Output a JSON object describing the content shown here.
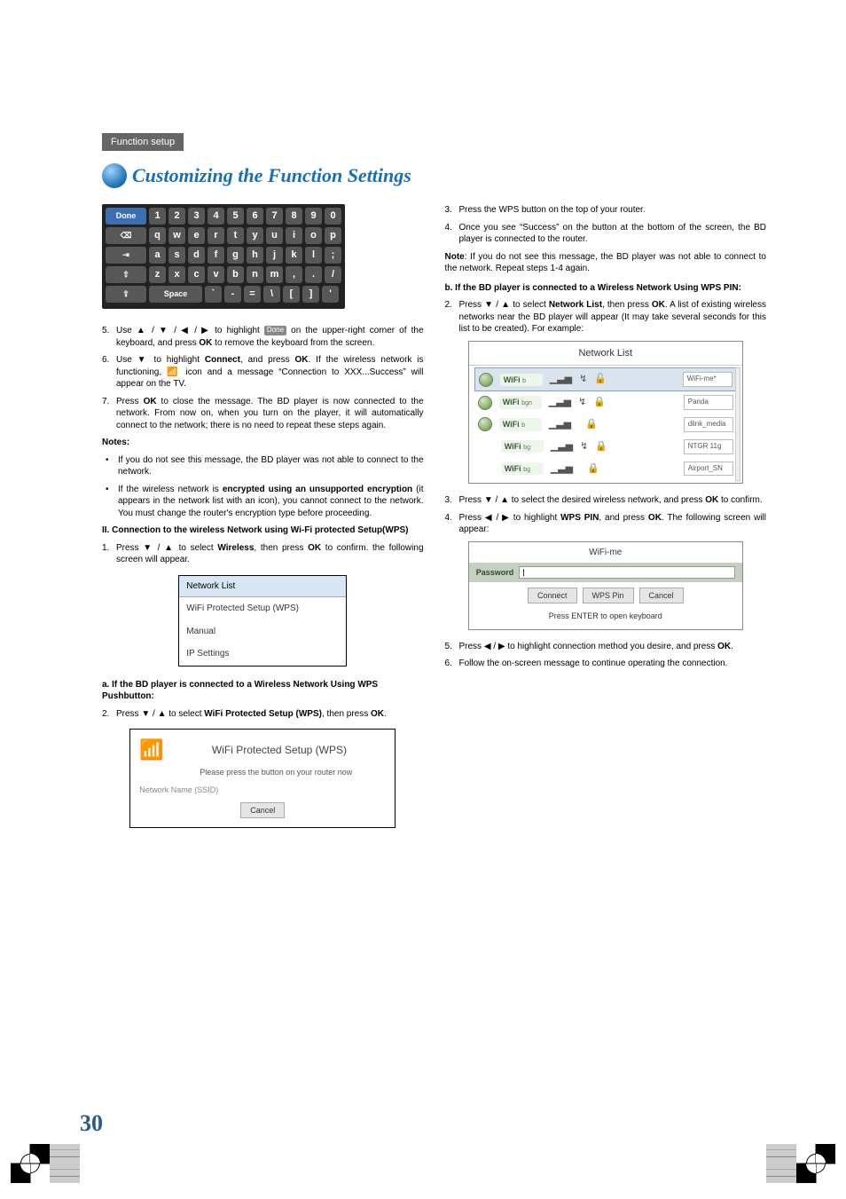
{
  "header": {
    "section": "Function setup"
  },
  "title": "Customizing the Function Settings",
  "keyboard": {
    "row1_first": "Done",
    "row1": [
      "1",
      "2",
      "3",
      "4",
      "5",
      "6",
      "7",
      "8",
      "9",
      "0"
    ],
    "row2_first": "⌫",
    "row2": [
      "q",
      "w",
      "e",
      "r",
      "t",
      "y",
      "u",
      "i",
      "o",
      "p"
    ],
    "row3_first": "⇥",
    "row3": [
      "a",
      "s",
      "d",
      "f",
      "g",
      "h",
      "j",
      "k",
      "l",
      ";"
    ],
    "row4_first": "⇧",
    "row4": [
      "z",
      "x",
      "c",
      "v",
      "b",
      "n",
      "m",
      ",",
      ".",
      "/"
    ],
    "row5_first": "⇪",
    "row5_space": "Space",
    "row5": [
      "`",
      "-",
      "=",
      "\\",
      "[",
      "]",
      "'"
    ]
  },
  "left": {
    "s5_pre": "Use ▲ / ▼ / ◀ / ▶ to highlight ",
    "s5_chip": "Done",
    "s5_post": " on the upper-right corner of the keyboard, and press ",
    "s5_ok": "OK",
    "s5_end": " to remove the keyboard from the screen.",
    "s6_a": "Use ▼ to highlight ",
    "s6_b": "Connect",
    "s6_c": ", and press ",
    "s6_d": "OK",
    "s6_e": ". If the wireless network is functioning, ",
    "s6_icon": "📶",
    "s6_f": " icon and a message “Connection to XXX...Success” will appear on the TV.",
    "s7_a": "Press ",
    "s7_b": "OK",
    "s7_c": " to close the message. The BD player is now connected to the network. From now on, when you turn on the player, it will automatically connect to the network; there is no need to repeat these steps again.",
    "notes_label": "Notes:",
    "note1": "If you do not see this message, the BD player was not able to connect to the network.",
    "note2_a": "If the wireless network is ",
    "note2_b": "encrypted using an unsupported encryption",
    "note2_c": " (it appears in the network list with an icon), you cannot connect to the network. You must change the router's encryption type before proceeding.",
    "ii_head": "II. Connection to the wireless Network using Wi-Fi protected Setup(WPS)",
    "ii_1_a": "Press ▼ / ▲ to select ",
    "ii_1_b": "Wireless",
    "ii_1_c": ", then press ",
    "ii_1_d": "OK",
    "ii_1_e": " to confirm. the following screen will appear.",
    "menu": {
      "head": "Network List",
      "i1": "WiFi Protected Setup (WPS)",
      "i2": "Manual",
      "i3": "IP Settings"
    },
    "a_head": "a. If the BD player is connected to a Wireless Network Using WPS Pushbutton:",
    "a2_a": "Press ▼ / ▲ to select ",
    "a2_b": "WiFi Protected Setup (WPS)",
    "a2_c": ", then press ",
    "a2_d": "OK",
    "a2_e": ".",
    "wps": {
      "title": "WiFi Protected Setup (WPS)",
      "sub": "Please press the button on your router now",
      "ssid": "Network Name (SSID)",
      "cancel": "Cancel"
    }
  },
  "right": {
    "s3": "Press the WPS button on the top of your router.",
    "s4": "Once you see “Success” on the button at the bottom of the screen, the BD player is connected to the router.",
    "note_a": "Note",
    "note_b": ": If you do not see this message, the BD player was not able to connect to the network. Repeat steps 1-4 again.",
    "b_head": "b. If the BD player is connected to a Wireless Network Using WPS PIN:",
    "b2_a": "Press ▼ / ▲ to select ",
    "b2_b": "Network List",
    "b2_c": ", then press ",
    "b2_d": "OK",
    "b2_e": ". A list of existing wireless networks near the BD player will appear (It may take several seconds for this list to be created). For example:",
    "netlist": {
      "title": "Network List",
      "rows": [
        {
          "ssid": "WiFi",
          "badge": "b",
          "name": "WiFi-me*",
          "wps": "↯",
          "lock": "🔓",
          "globe": true
        },
        {
          "ssid": "WiFi",
          "badge": "bgn",
          "name": "Panda",
          "wps": "↯",
          "lock": "🔒",
          "globe": true
        },
        {
          "ssid": "WiFi",
          "badge": "b",
          "name": "dlink_media",
          "wps": "",
          "lock": "🔒",
          "globe": true
        },
        {
          "ssid": "WiFi",
          "badge": "bg",
          "name": "NTGR 11g",
          "wps": "↯",
          "lock": "🔒",
          "globe": false
        },
        {
          "ssid": "WiFi",
          "badge": "bg",
          "name": "Airport_SN",
          "wps": "",
          "lock": "🔒",
          "globe": false
        }
      ]
    },
    "s3b_a": "Press ▼ / ▲ to select the desired wireless network, and press ",
    "s3b_b": "OK",
    "s3b_c": " to confirm.",
    "s4b_a": "Press ◀ / ▶ to highlight ",
    "s4b_b": "WPS PIN",
    "s4b_c": ", and press ",
    "s4b_d": "OK",
    "s4b_e": ". The following screen will appear:",
    "wifime": {
      "title": "WiFi-me",
      "pwd": "Password",
      "b1": "Connect",
      "b2": "WPS Pin",
      "b3": "Cancel",
      "hint": "Press ENTER to open keyboard"
    },
    "s5_a": "Press ◀ / ▶ to highlight connection method you desire, and press ",
    "s5_b": "OK",
    "s5_c": ".",
    "s6": "Follow the on-screen message to continue operating the connection."
  },
  "page_number": "30"
}
